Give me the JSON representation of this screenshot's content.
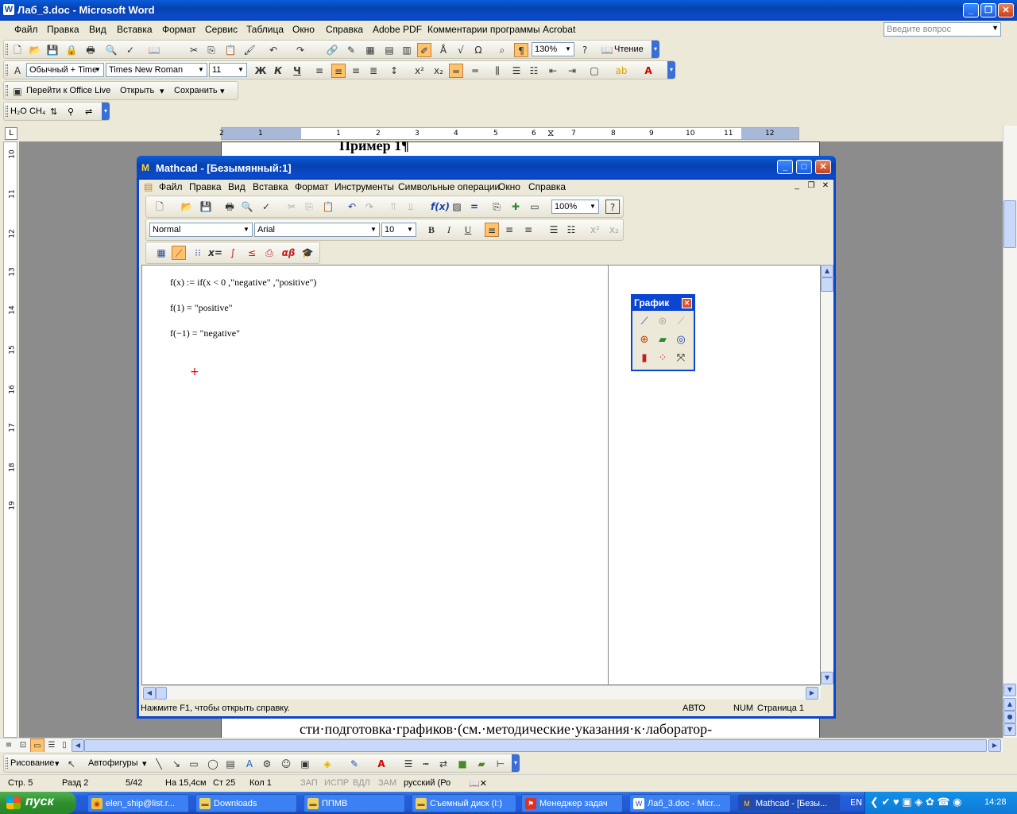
{
  "word": {
    "title": "Лаб_3.doc - Microsoft Word",
    "menu": [
      "Файл",
      "Правка",
      "Вид",
      "Вставка",
      "Формат",
      "Сервис",
      "Таблица",
      "Окно",
      "Справка",
      "Adobe PDF",
      "Комментарии программы Acrobat"
    ],
    "ask_placeholder": "Введите вопрос",
    "zoom": "130%",
    "reading_label": "Чтение",
    "style_value": "Обычный + Time",
    "font_value": "Times New Roman",
    "size_value": "11",
    "bold_label": "Ж",
    "italic_label": "К",
    "underline_label": "Ч",
    "office_live": "Перейти к Office Live",
    "open_label": "Открыть",
    "save_label": "Сохранить",
    "chem_bar": [
      "H₂O",
      "CH₄",
      "⇅",
      "⚲",
      "⇌"
    ],
    "ruler_numbers": [
      "2",
      "1",
      "1",
      "2",
      "3",
      "4",
      "5",
      "6",
      "7",
      "8",
      "9",
      "10",
      "11",
      "12"
    ],
    "vruler_numbers": [
      "10",
      "11",
      "12",
      "13",
      "14",
      "15",
      "16",
      "17",
      "18",
      "19"
    ],
    "doc_heading": "Пример 1¶",
    "doc_bottom_text": "сти·подготовка·графиков·(см.·методические·указания·к·лаборатор-",
    "draw_label": "Рисование",
    "autoshapes_label": "Автофигуры",
    "status": {
      "page": "Стр. 5",
      "section": "Разд 2",
      "pages": "5/42",
      "at": "На 15,4см",
      "line": "Ст 25",
      "col": "Кол 1",
      "rec": "ЗАП",
      "trk": "ИСПР",
      "ext": "ВДЛ",
      "ovr": "ЗАМ",
      "lang": "русский (Ро"
    }
  },
  "mathcad": {
    "title": "Mathcad - [Безымянный:1]",
    "menu": [
      "Файл",
      "Правка",
      "Вид",
      "Вставка",
      "Формат",
      "Инструменты",
      "Символьные операции",
      "Окно",
      "Справка"
    ],
    "zoom": "100%",
    "style_value": "Normal",
    "font_value": "Arial",
    "size_value": "10",
    "lines": [
      "f(x) := if(x < 0 ,\"negative\" ,\"positive\")",
      "f(1) = \"positive\"",
      "f(−1) = \"negative\""
    ],
    "status_help": "Нажмите F1, чтобы открыть справку.",
    "status_mode": "АВТО",
    "status_num": "NUM",
    "status_page": "Страница 1",
    "palette_title": "График"
  },
  "taskbar": {
    "start": "пуск",
    "items": [
      "elen_ship@list.r...",
      "Downloads",
      "ППМВ",
      "Съемный диск (I:)",
      "Менеджер задач",
      "Лаб_3.doc - Micr...",
      "Mathcad - [Безы..."
    ],
    "lang": "EN",
    "time": "14:28"
  }
}
